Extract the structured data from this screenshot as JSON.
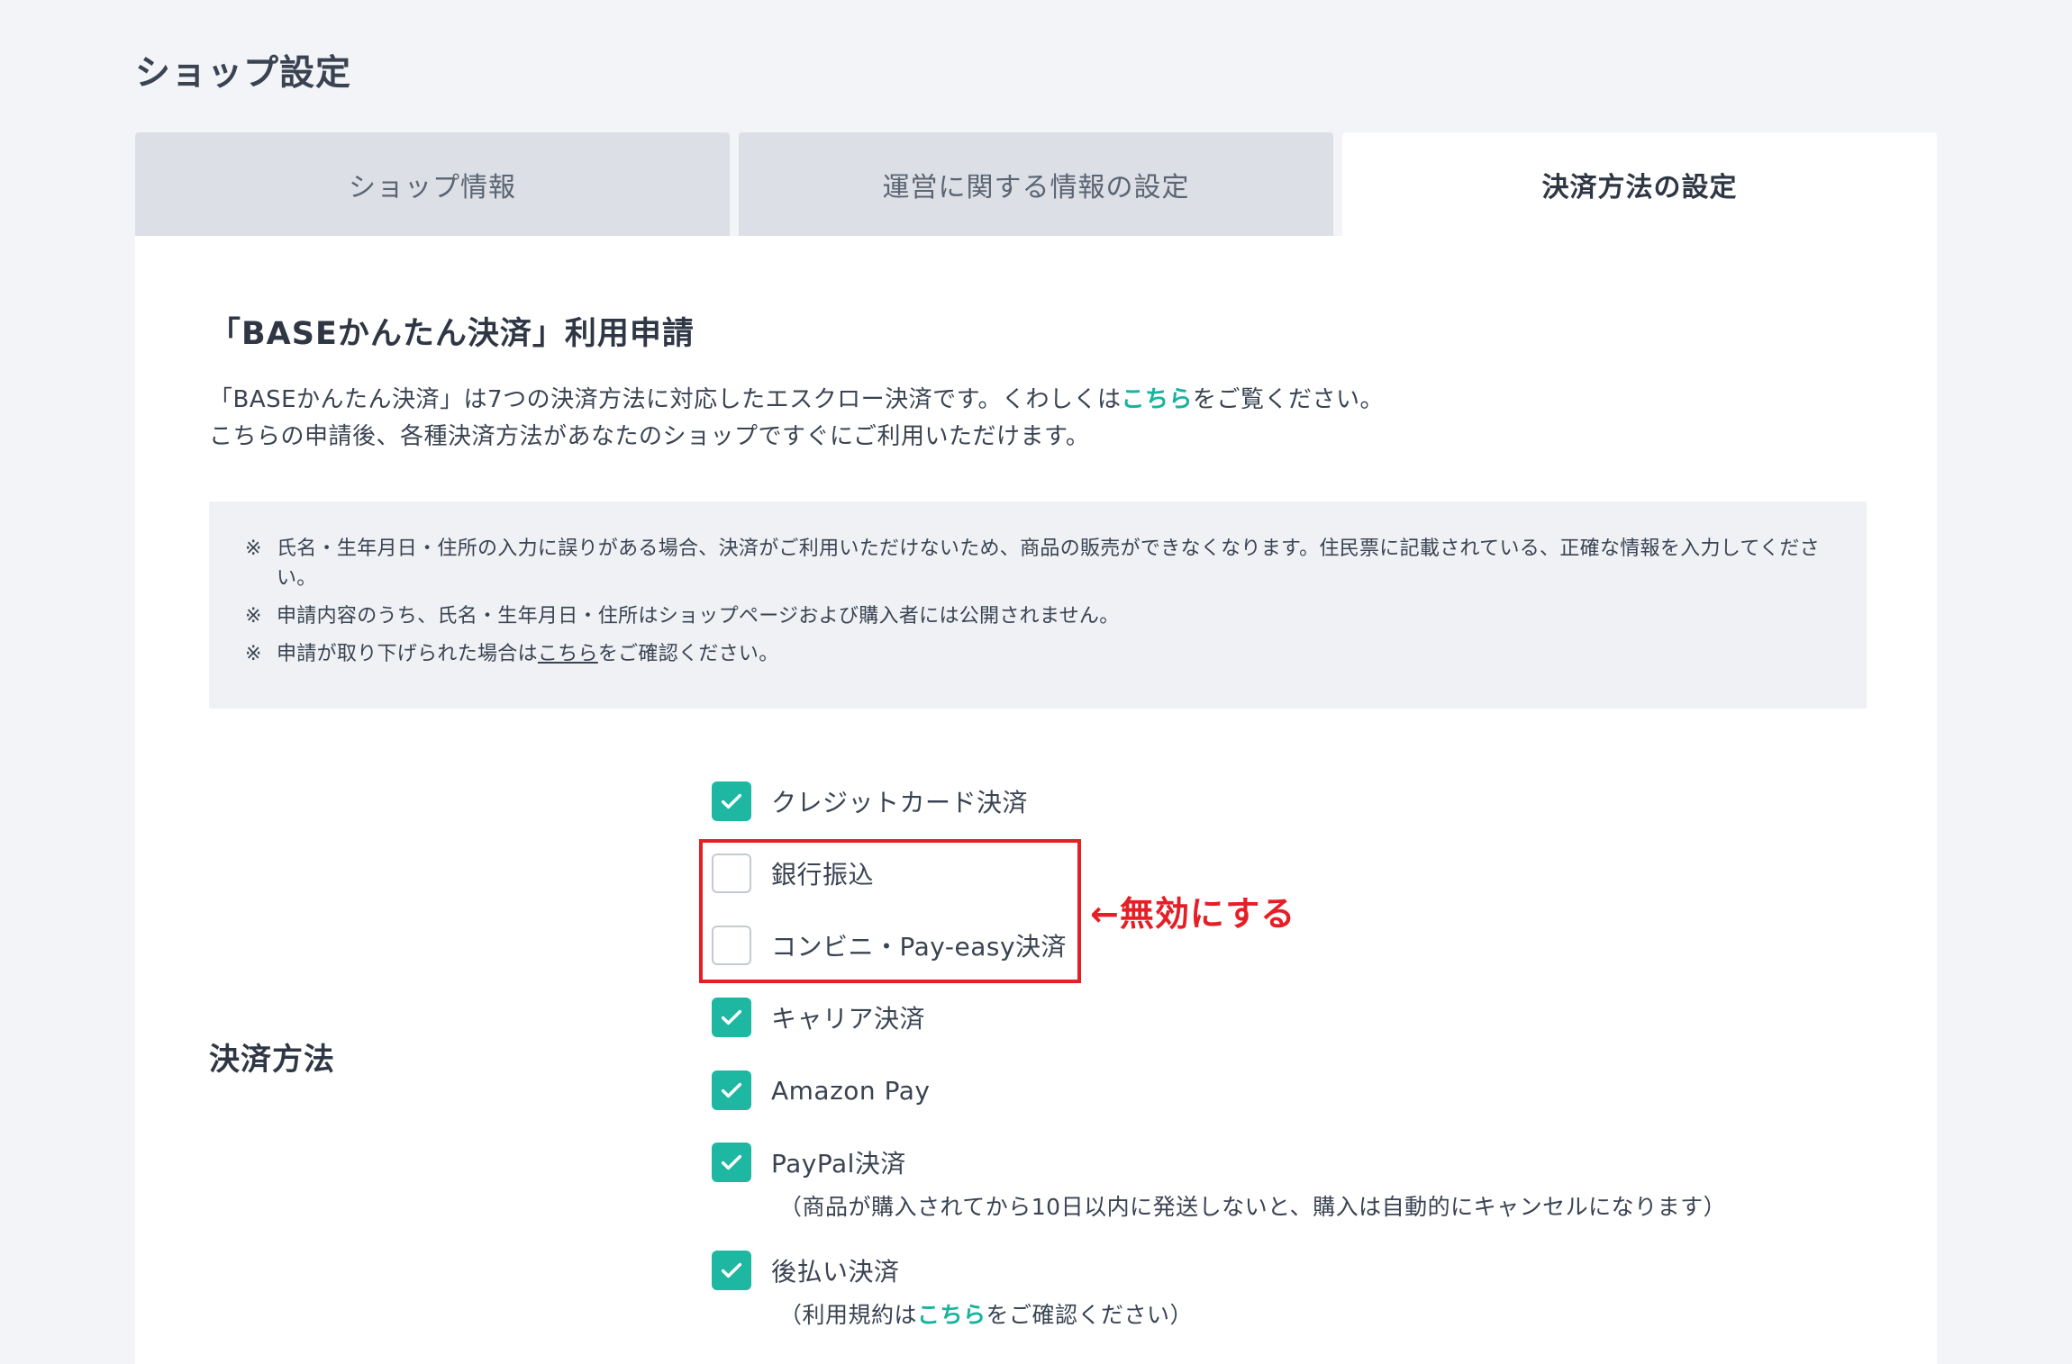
{
  "page_title": "ショップ設定",
  "tabs": [
    {
      "label": "ショップ情報",
      "active": false
    },
    {
      "label": "運営に関する情報の設定",
      "active": false
    },
    {
      "label": "決済方法の設定",
      "active": true
    }
  ],
  "section": {
    "title": "「BASEかんたん決済」利用申請",
    "desc_line1_pre": "「BASEかんたん決済」は7つの決済方法に対応したエスクロー決済です。くわしくは",
    "desc_line1_link": "こちら",
    "desc_line1_post": "をご覧ください。",
    "desc_line2": "こちらの申請後、各種決済方法があなたのショップですぐにご利用いただけます。"
  },
  "notice": {
    "mark": "※",
    "item1": "氏名・生年月日・住所の入力に誤りがある場合、決済がご利用いただけないため、商品の販売ができなくなります。住民票に記載されている、正確な情報を入力してください。",
    "item2": "申請内容のうち、氏名・生年月日・住所はショップページおよび購入者には公開されません。",
    "item3_pre": "申請が取り下げられた場合は",
    "item3_link": "こちら",
    "item3_post": "をご確認ください。"
  },
  "payment": {
    "label": "決済方法",
    "options": [
      {
        "label": "クレジットカード決済",
        "checked": true
      },
      {
        "label": "銀行振込",
        "checked": false
      },
      {
        "label": "コンビニ・Pay-easy決済",
        "checked": false
      },
      {
        "label": "キャリア決済",
        "checked": true
      },
      {
        "label": "Amazon Pay",
        "checked": true
      },
      {
        "label": "PayPal決済",
        "checked": true
      },
      {
        "label": "後払い決済",
        "checked": true
      }
    ],
    "paypal_note": "（商品が購入されてから10日以内に発送しないと、購入は自動的にキャンセルになります）",
    "atobarai_note_pre": "（利用規約は",
    "atobarai_note_link": "こちら",
    "atobarai_note_post": "をご確認ください）"
  },
  "annotation": {
    "text": "←無効にする"
  },
  "colors": {
    "accent": "#1db7a2",
    "link": "#19b39f",
    "annotation": "#e61e26",
    "background": "#f3f4f7"
  }
}
